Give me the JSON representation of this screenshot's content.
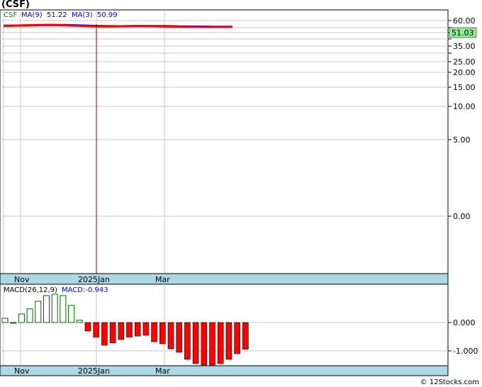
{
  "title": "(CSF)",
  "footer": "© 12Stocks.com",
  "price_legend": {
    "ticker": "CSF",
    "ma9_label": "MA(9)",
    "ma9_value": "51.22",
    "ma3_label": "MA(3)",
    "ma3_value": "50.99"
  },
  "current_price": "51.03",
  "macd_legend": {
    "label": "MACD(26,12,9)",
    "value_label": "MACD:-0.943"
  },
  "colors": {
    "ma9": "#0000ff",
    "ma3": "#ff0000",
    "price": "#000000",
    "hist_pos": "#006400",
    "hist_neg": "#ff0000",
    "axis_band": "#add8e6",
    "price_box": "#90ee90",
    "ticker": "#008000",
    "ma_text": "#0000cc"
  },
  "chart_data": [
    {
      "type": "line",
      "scale": "log-like",
      "y_ticks": [
        "60.00",
        "50.00",
        "45.00",
        "40.00",
        "35.00",
        "30.00",
        "25.00",
        "20.00",
        "15.00",
        "10.00",
        "5.00",
        "0.00"
      ],
      "y_tick_labels_shown": [
        "60.00",
        "35.00",
        "25.00",
        "20.00",
        "15.00",
        "10.00",
        "5.00",
        "0.00"
      ],
      "x_tick_labels": [
        "Nov",
        "2025Jan",
        "Mar"
      ],
      "series": [
        {
          "name": "MA(9)",
          "values": [
            52.6,
            52.8,
            53.0,
            53.2,
            53.5,
            53.7,
            53.8,
            53.7,
            53.4,
            53.0,
            52.6,
            52.3,
            52.1,
            52.0,
            52.1,
            52.2,
            52.3,
            52.3,
            52.2,
            52.0,
            51.8,
            51.6,
            51.5,
            51.4,
            51.3,
            51.25,
            51.22
          ]
        },
        {
          "name": "MA(3)",
          "values": [
            52.7,
            52.9,
            53.1,
            53.4,
            53.8,
            53.9,
            53.7,
            53.3,
            52.9,
            52.4,
            52.0,
            51.8,
            51.8,
            51.9,
            52.1,
            52.3,
            52.3,
            52.1,
            51.7,
            51.4,
            51.2,
            51.1,
            51.0,
            50.9,
            50.95,
            51.0,
            50.99
          ]
        }
      ],
      "last_price": 51.03
    },
    {
      "type": "bar",
      "y_ticks": [
        "0.000",
        "-1.000"
      ],
      "x_tick_labels": [
        "Nov",
        "2025Jan",
        "Mar"
      ],
      "series": [
        {
          "name": "MACD(26,12,9)",
          "values": [
            0.15,
            0.0,
            0.3,
            0.48,
            0.75,
            0.95,
            1.0,
            0.95,
            0.6,
            0.08,
            -0.3,
            -0.52,
            -0.8,
            -0.72,
            -0.6,
            -0.52,
            -0.48,
            -0.45,
            -0.68,
            -0.75,
            -0.93,
            -1.05,
            -1.3,
            -1.45,
            -1.5,
            -1.5,
            -1.45,
            -1.3,
            -1.1,
            -0.943
          ]
        }
      ]
    }
  ]
}
